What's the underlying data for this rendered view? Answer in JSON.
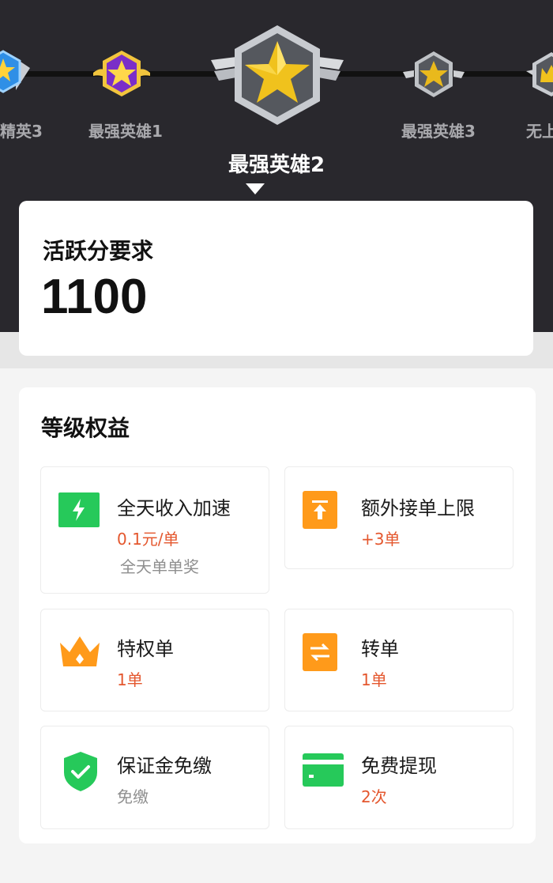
{
  "levels": {
    "prev2": "精英3",
    "prev1": "最强英雄1",
    "current": "最强英雄2",
    "next1": "最强英雄3",
    "next2": "无上"
  },
  "requirement": {
    "title": "活跃分要求",
    "value": "1100"
  },
  "benefits": {
    "title": "等级权益",
    "items": [
      {
        "name": "全天收入加速",
        "value": "0.1元/单",
        "note": "全天单单奖",
        "icon": "lightning-icon",
        "color": "#26c95a"
      },
      {
        "name": "额外接单上限",
        "value": "+3单",
        "icon": "upload-arrow-icon",
        "color": "#ff9a1a"
      },
      {
        "name": "特权单",
        "value": "1单",
        "icon": "crown-icon",
        "color": "#ff9a1a"
      },
      {
        "name": "转单",
        "value": "1单",
        "icon": "swap-arrows-icon",
        "color": "#ff9a1a"
      },
      {
        "name": "保证金免缴",
        "value": "免缴",
        "icon": "shield-check-icon",
        "color": "#26c95a"
      },
      {
        "name": "免费提现",
        "value": "2次",
        "icon": "card-icon",
        "color": "#26c95a"
      }
    ]
  },
  "colors": {
    "header_bg": "#29282d",
    "accent_orange": "#e4572e",
    "green": "#26c95a",
    "orange": "#ff9a1a"
  }
}
